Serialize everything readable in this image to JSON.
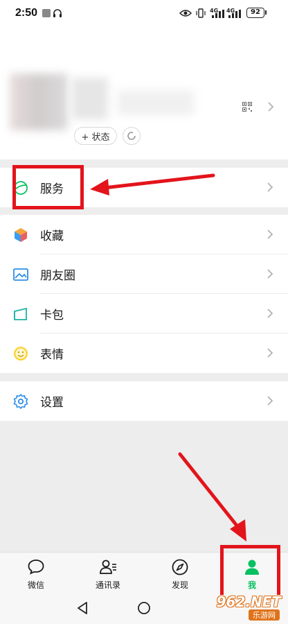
{
  "status_bar": {
    "time": "2:50",
    "battery": "92",
    "network_label": "4G"
  },
  "profile": {
    "status_button_label": "+ 状态"
  },
  "menu": {
    "services": "服务",
    "favorites": "收藏",
    "moments": "朋友圈",
    "cards": "卡包",
    "stickers": "表情",
    "settings": "设置"
  },
  "tabbar": {
    "chats": "微信",
    "contacts": "通讯录",
    "discover": "发现",
    "me": "我"
  },
  "watermark": {
    "brand": "962.NET",
    "sub": "乐游网"
  },
  "colors": {
    "accent_green": "#07c160",
    "annotation_red": "#e3141b"
  }
}
